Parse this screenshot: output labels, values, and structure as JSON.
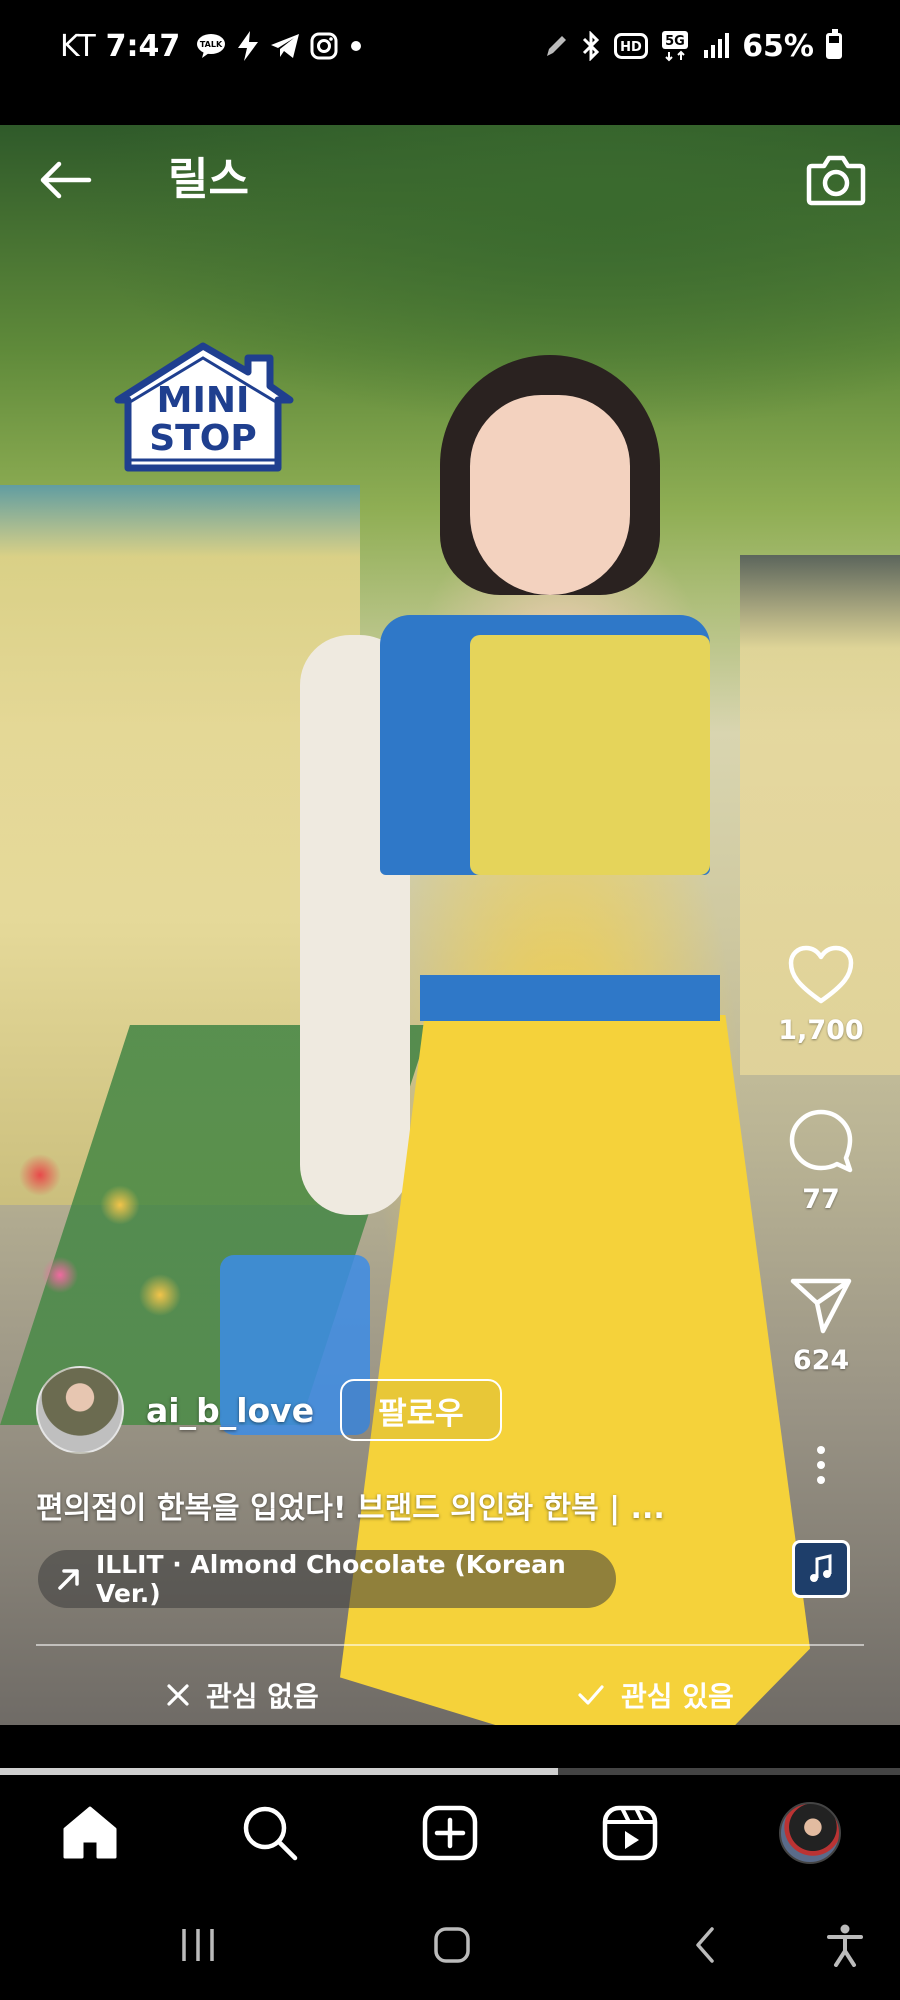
{
  "status_bar": {
    "carrier": "KT",
    "time": "7:47",
    "battery": "65%",
    "battery_level": 0.65,
    "icons_left": [
      "talk-icon",
      "bolt-icon",
      "telegram-icon",
      "instagram-icon",
      "dot-icon"
    ],
    "icons_right": [
      "pen-icon",
      "bluetooth-icon",
      "hd-icon",
      "5g-icon",
      "signal-icon",
      "battery-icon"
    ],
    "hd_label": "HD",
    "net_label": "5G"
  },
  "header": {
    "title": "릴스"
  },
  "overlay_logo": {
    "line1": "MINI",
    "line2": "STOP"
  },
  "actions": {
    "likes": "1,700",
    "comments": "77",
    "shares": "624"
  },
  "post": {
    "username": "ai_b_love",
    "follow_label": "팔로우",
    "caption": "편의점이 한복을 입었다! 브랜드 의인화 한복 | ...",
    "music": "ILLIT · Almond Chocolate (Korean Ver.)"
  },
  "interest": {
    "not_interested": "관심 없음",
    "interested": "관심 있음"
  },
  "progress": {
    "fraction": 0.62
  },
  "colors": {
    "accent_blue": "#1f3f8f",
    "background": "#000000"
  }
}
